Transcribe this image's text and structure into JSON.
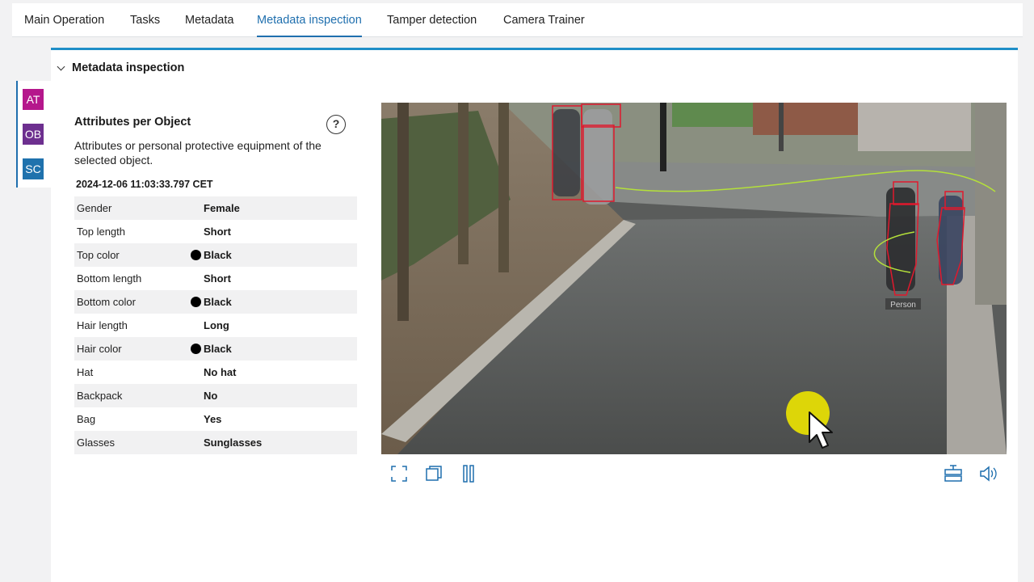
{
  "tabs": [
    {
      "label": "Main Operation"
    },
    {
      "label": "Tasks"
    },
    {
      "label": "Metadata"
    },
    {
      "label": "Metadata inspection"
    },
    {
      "label": "Tamper detection"
    },
    {
      "label": "Camera Trainer"
    }
  ],
  "active_tab": "Metadata inspection",
  "section": {
    "title": "Metadata inspection"
  },
  "sidebar": {
    "items": [
      {
        "label": "AT",
        "color": "#b5178c"
      },
      {
        "label": "OB",
        "color": "#6d2f8f"
      },
      {
        "label": "SC",
        "color": "#1f72ad"
      }
    ]
  },
  "panel": {
    "title": "Attributes per Object",
    "help_icon": "?",
    "description": "Attributes or personal protective equipment of the selected object.",
    "timestamp": "2024-12-06 11:03:33.797 CET",
    "attributes": [
      {
        "key": "Gender",
        "value": "Female"
      },
      {
        "key": "Top length",
        "value": "Short"
      },
      {
        "key": "Top color",
        "value": "Black",
        "swatch": "#000000"
      },
      {
        "key": "Bottom length",
        "value": "Short"
      },
      {
        "key": "Bottom color",
        "value": "Black",
        "swatch": "#000000"
      },
      {
        "key": "Hair length",
        "value": "Long"
      },
      {
        "key": "Hair color",
        "value": "Black",
        "swatch": "#000000"
      },
      {
        "key": "Hat",
        "value": "No hat"
      },
      {
        "key": "Backpack",
        "value": "No"
      },
      {
        "key": "Bag",
        "value": "Yes"
      },
      {
        "key": "Glasses",
        "value": "Sunglasses"
      }
    ]
  },
  "video": {
    "object_label": "Person",
    "controls": [
      "fullscreen-icon",
      "popout-icon",
      "pause-icon",
      "metadata-overlay-icon",
      "volume-icon"
    ]
  },
  "colors": {
    "accent": "#1f6fae",
    "section_bar": "#1f8ec7",
    "bbox": "#e0192d",
    "trajectory": "#b4e03a",
    "cursor_highlight": "#ece400"
  }
}
